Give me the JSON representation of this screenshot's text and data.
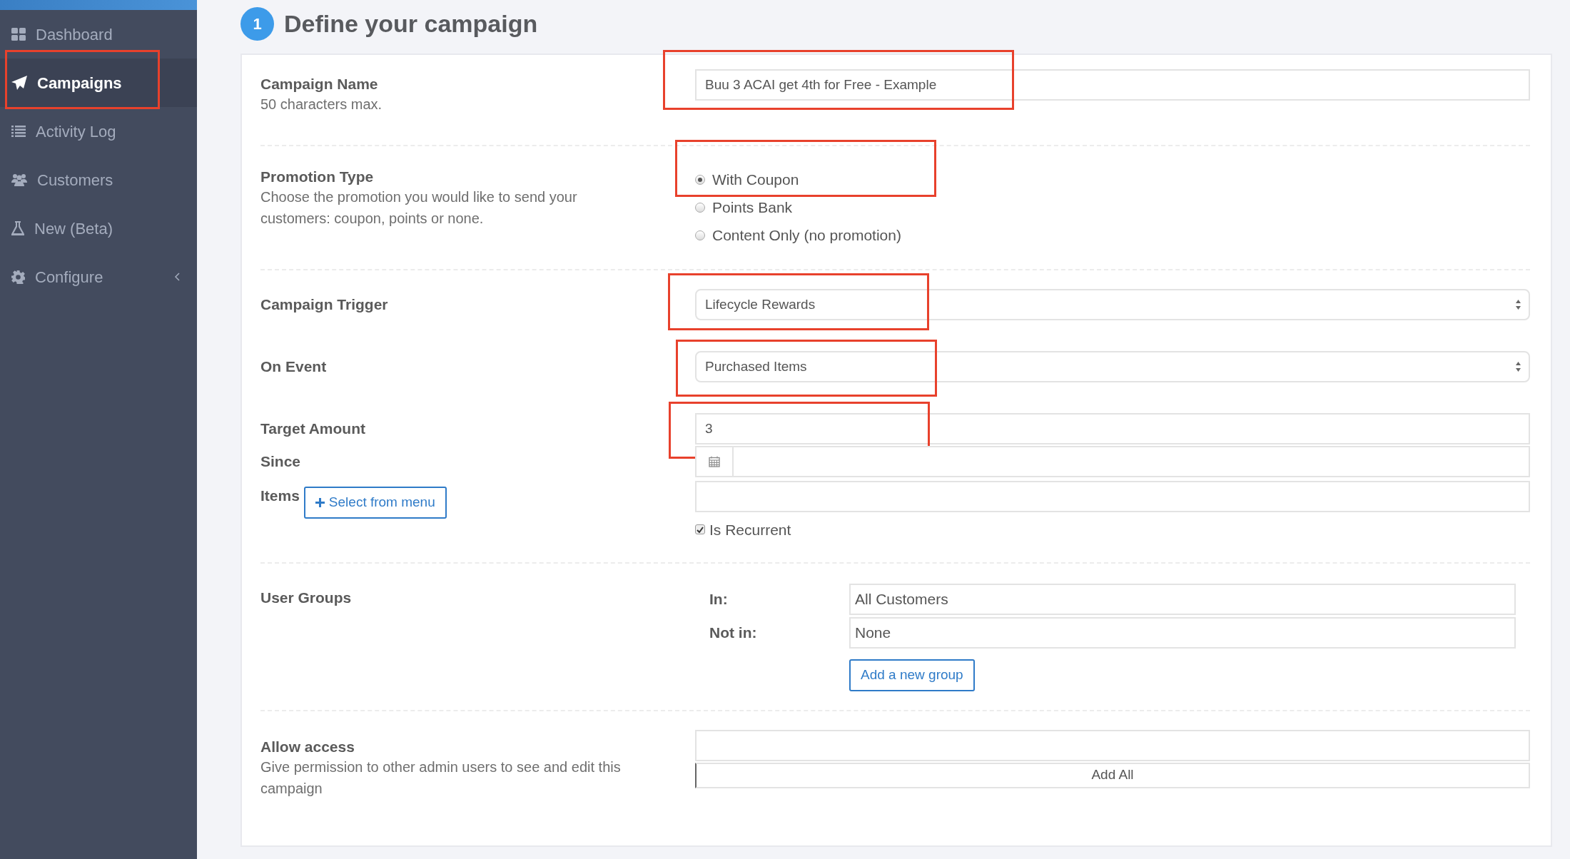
{
  "sidebar": {
    "items": [
      {
        "label": "Dashboard",
        "selected": false,
        "kind": "link"
      },
      {
        "label": "Campaigns",
        "selected": true,
        "highlighted": true,
        "kind": "link"
      },
      {
        "label": "Activity Log",
        "selected": false,
        "kind": "link"
      },
      {
        "label": "Customers",
        "selected": false,
        "kind": "link"
      },
      {
        "label": "New (Beta)",
        "selected": false,
        "kind": "link"
      },
      {
        "label": "Configure",
        "selected": false,
        "kind": "submenu"
      }
    ]
  },
  "heading": {
    "step": "1",
    "title": "Define your campaign"
  },
  "sections": [
    {
      "kind": "text",
      "label": "Campaign Name",
      "description": "50 characters max.",
      "value": "Buu 3 ACAI get 4th for Free - Example",
      "highlighted": true
    },
    {
      "kind": "radio",
      "label": "Promotion Type",
      "description": "Choose the promotion you would like to send your customers: coupon, points or none.",
      "options": [
        {
          "label": "With Coupon",
          "selected": true,
          "highlighted": true
        },
        {
          "label": "Points Bank",
          "selected": false
        },
        {
          "label": "Content Only (no promotion)",
          "selected": false
        }
      ]
    },
    {
      "kind": "trigger",
      "fields": [
        {
          "kind": "select",
          "label": "Campaign Trigger",
          "value": "Lifecycle Rewards",
          "highlighted": true
        },
        {
          "kind": "select",
          "label": "On Event",
          "value": "Purchased Items",
          "highlighted": true
        },
        {
          "kind": "text",
          "label": "Target Amount",
          "value": "3",
          "highlighted": true
        },
        {
          "kind": "date",
          "label": "Since"
        },
        {
          "kind": "items",
          "label": "Items",
          "button": "Select from menu"
        }
      ],
      "recurrent": {
        "label": "Is Recurrent",
        "checked": true
      }
    },
    {
      "kind": "groups",
      "label": "User Groups",
      "rows": [
        {
          "label": "In:",
          "value": "All Customers"
        },
        {
          "label": "Not in:",
          "value": "None"
        }
      ],
      "button": "Add a new group"
    },
    {
      "kind": "access",
      "label": "Allow access",
      "description": "Give permission to other admin users to see and edit this campaign",
      "button": "Add All"
    }
  ]
}
